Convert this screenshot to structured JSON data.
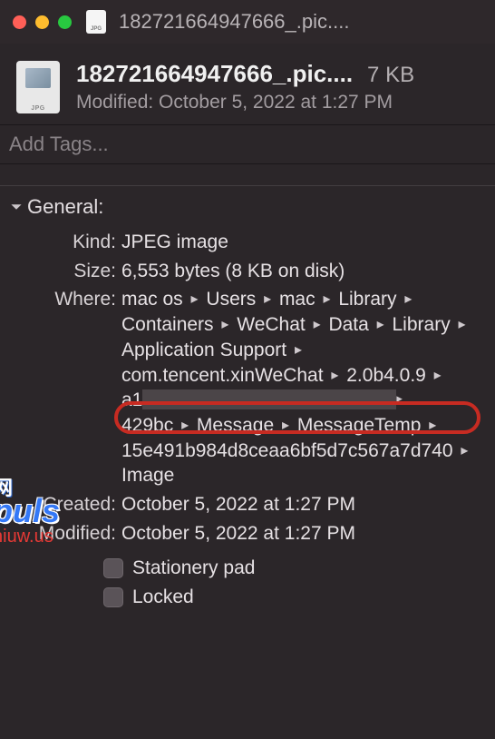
{
  "window_title": "182721664947666_.pic....",
  "file": {
    "icon_label": "JPG",
    "name": "182721664947666_.pic....",
    "size": "7 KB",
    "modified_header": "Modified: October 5, 2022 at 1:27 PM"
  },
  "tags": {
    "placeholder": "Add Tags..."
  },
  "section_general_title": "General:",
  "general": {
    "kind_label": "Kind:",
    "kind_value": "JPEG image",
    "size_label": "Size:",
    "size_value": "6,553 bytes (8 KB on disk)",
    "where_label": "Where:",
    "where_path": [
      "mac os",
      "Users",
      "mac",
      "Library",
      "Containers",
      "WeChat",
      "Data",
      "Library",
      "Application Support",
      "com.tencent.xinWeChat",
      "2.0b4.0.9",
      "a1",
      "429bc",
      "Message",
      "MessageTemp",
      "15e491b984d8ceaa6bf5d7c567a7d740",
      "Image"
    ],
    "where_segment_a1": "a1",
    "where_segment_429bc": "429bc",
    "where_segment_msg": "Message",
    "where_segment_msgtemp": "MessageTemp",
    "where_segment_hash": "15e491b984d8ceaa6bf5d7c567a7d740",
    "where_segment_image": "Image",
    "created_label": "Created:",
    "created_value": "October 5, 2022 at 1:27 PM",
    "modified_label": "Modified:",
    "modified_value": "October 5, 2022 at 1:27 PM",
    "stationery_label": "Stationery pad",
    "locked_label": "Locked"
  },
  "watermark": {
    "line0": "网",
    "line1": "puls",
    "line2": "niuw.us"
  }
}
